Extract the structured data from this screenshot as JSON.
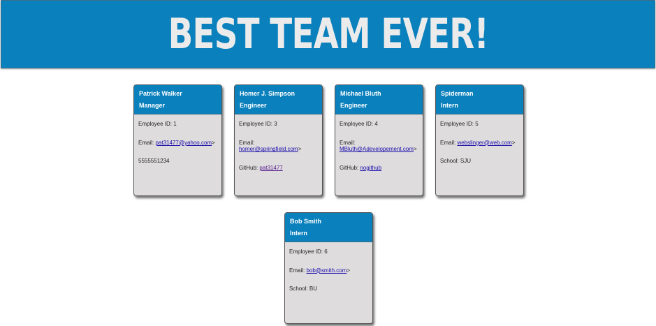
{
  "header": {
    "title": "BEST TEAM EVER!"
  },
  "labels": {
    "id": "Employee ID: ",
    "email": "Email: ",
    "github": "GitHub: ",
    "school": "School: ",
    "close": ">"
  },
  "cards": [
    {
      "name": "Patrick Walker",
      "role": "Manager",
      "id": "1",
      "email": "pat31477@yahoo.com",
      "extra": "5555551234"
    },
    {
      "name": "Homer J. Simpson",
      "role": "Engineer",
      "id": "3",
      "email": "homer@springfield.com",
      "extra": "pat31477"
    },
    {
      "name": "Michael Bluth",
      "role": "Engineer",
      "id": "4",
      "email": "MBluth@Adevelopement.com",
      "extra": "nogithub"
    },
    {
      "name": "Spiderman",
      "role": "Intern",
      "id": "5",
      "email": "webslinger@web.com",
      "extra": "SJU"
    },
    {
      "name": "Bob Smith",
      "role": "Intern",
      "id": "6",
      "email": "bob@smith.com",
      "extra": "BU"
    }
  ]
}
